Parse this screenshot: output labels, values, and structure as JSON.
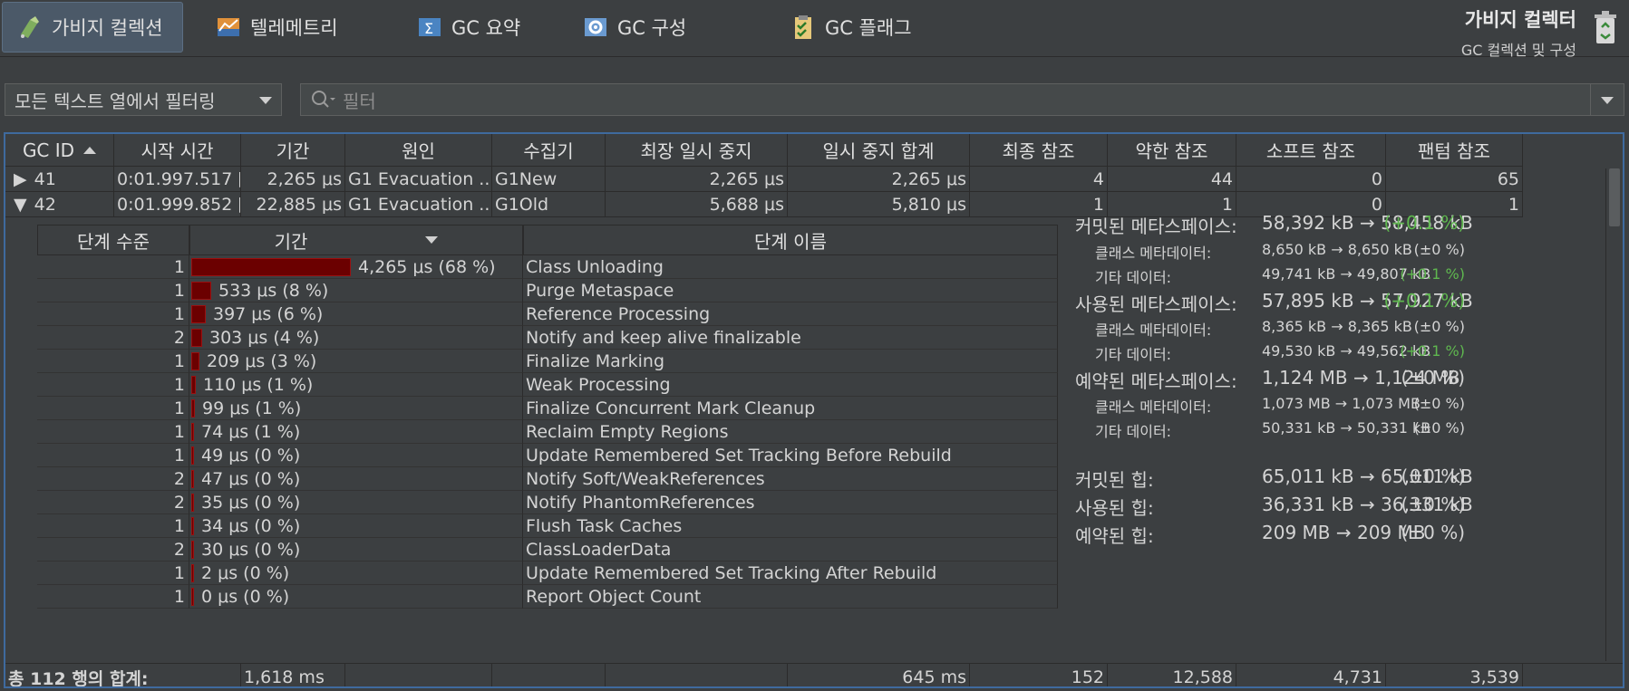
{
  "toolbar": {
    "tabs": [
      {
        "label": "가비지 컬렉션",
        "icon": "garbage-collection-icon",
        "active": true
      },
      {
        "label": "텔레메트리",
        "icon": "telemetry-icon",
        "active": false
      },
      {
        "label": "GC 요약",
        "icon": "gc-summary-icon",
        "active": false
      },
      {
        "label": "GC 구성",
        "icon": "gc-config-icon",
        "active": false
      },
      {
        "label": "GC 플래그",
        "icon": "gc-flags-icon",
        "active": false
      }
    ],
    "title": "가비지 컬렉터",
    "subtitle": "GC 컬렉션 및 구성"
  },
  "filter": {
    "select_value": "모든 텍스트 열에서 필터링",
    "search_placeholder": "필터"
  },
  "table": {
    "columns": [
      "GC ID",
      "시작 시간",
      "기간",
      "원인",
      "수집기",
      "최장 일시 중지",
      "일시 중지 합계",
      "최종 참조",
      "약한 참조",
      "소프트 참조",
      "팬텀 참조"
    ],
    "rows": [
      {
        "expanded": false,
        "id": "41",
        "start": "0:01.997.517 [...",
        "duration": "2,265 μs",
        "cause": "G1 Evacuation ...",
        "collector": "G1New",
        "longest": "2,265 μs",
        "sum": "2,265 μs",
        "final": "4",
        "weak": "44",
        "soft": "0",
        "phantom": "65"
      },
      {
        "expanded": true,
        "id": "42",
        "start": "0:01.999.852 [...",
        "duration": "22,885 μs",
        "cause": "G1 Evacuation ...",
        "collector": "G1Old",
        "longest": "5,688 μs",
        "sum": "5,810 μs",
        "final": "1",
        "weak": "1",
        "soft": "0",
        "phantom": "1"
      }
    ],
    "footer": {
      "label": "총 112 행의 합계:",
      "duration": "1,618 ms",
      "sum": "645 ms",
      "final": "152",
      "weak": "12,588",
      "soft": "4,731",
      "phantom": "3,539"
    }
  },
  "phases": {
    "columns": [
      "단계 수준",
      "기간",
      "단계 이름"
    ],
    "bar_color": "#6b0000",
    "rows": [
      {
        "level": "1",
        "duration": "4,265 μs (68 %)",
        "fraction": 0.68,
        "name": "Class Unloading"
      },
      {
        "level": "1",
        "duration": "533 μs (8 %)",
        "fraction": 0.085,
        "name": "Purge Metaspace"
      },
      {
        "level": "1",
        "duration": "397 μs (6 %)",
        "fraction": 0.063,
        "name": "Reference Processing"
      },
      {
        "level": "2",
        "duration": "303 μs (4 %)",
        "fraction": 0.048,
        "name": "Notify and keep alive finalizable"
      },
      {
        "level": "1",
        "duration": "209 μs (3 %)",
        "fraction": 0.033,
        "name": "Finalize Marking"
      },
      {
        "level": "1",
        "duration": "110 μs (1 %)",
        "fraction": 0.018,
        "name": "Weak Processing"
      },
      {
        "level": "1",
        "duration": "99 μs (1 %)",
        "fraction": 0.016,
        "name": "Finalize Concurrent Mark Cleanup"
      },
      {
        "level": "1",
        "duration": "74 μs (1 %)",
        "fraction": 0.012,
        "name": "Reclaim Empty Regions"
      },
      {
        "level": "1",
        "duration": "49 μs (0 %)",
        "fraction": 0.008,
        "name": "Update Remembered Set Tracking Before Rebuild"
      },
      {
        "level": "2",
        "duration": "47 μs (0 %)",
        "fraction": 0.0075,
        "name": "Notify Soft/WeakReferences"
      },
      {
        "level": "2",
        "duration": "35 μs (0 %)",
        "fraction": 0,
        "name": "Notify PhantomReferences"
      },
      {
        "level": "1",
        "duration": "34 μs (0 %)",
        "fraction": 0,
        "name": "Flush Task Caches"
      },
      {
        "level": "2",
        "duration": "30 μs (0 %)",
        "fraction": 0,
        "name": "ClassLoaderData"
      },
      {
        "level": "1",
        "duration": "2 μs (0 %)",
        "fraction": 0,
        "name": "Update Remembered Set Tracking After Rebuild"
      },
      {
        "level": "1",
        "duration": "0 μs (0 %)",
        "fraction": 0,
        "name": "Report Object Count"
      }
    ]
  },
  "memory": {
    "green_color": "#5fb84f",
    "rows": [
      {
        "label": "커밋된 메타스페이스:",
        "value": "58,392 kB → 58,458 kB",
        "pct": "(+0.1 %)",
        "size": "big",
        "green": true
      },
      {
        "label": "클래스 메타데이터:",
        "value": "8,650 kB → 8,650 kB",
        "pct": "(±0 %)",
        "size": "small",
        "green": false
      },
      {
        "label": "기타 데이터:",
        "value": "49,741 kB → 49,807 kB",
        "pct": "(+0.1 %)",
        "size": "small",
        "green": true
      },
      {
        "label": "사용된 메타스페이스:",
        "value": "57,895 kB → 57,927 kB",
        "pct": "(+0.1 %)",
        "size": "big",
        "green": true
      },
      {
        "label": "클래스 메타데이터:",
        "value": "8,365 kB → 8,365 kB",
        "pct": "(±0 %)",
        "size": "small",
        "green": false
      },
      {
        "label": "기타 데이터:",
        "value": "49,530 kB → 49,562 kB",
        "pct": "(+0.1 %)",
        "size": "small",
        "green": true
      },
      {
        "label": "예약된 메타스페이스:",
        "value": "1,124 MB → 1,124 MB",
        "pct": "(±0 %)",
        "size": "big",
        "green": false
      },
      {
        "label": "클래스 메타데이터:",
        "value": "1,073 MB → 1,073 MB",
        "pct": "(±0 %)",
        "size": "small",
        "green": false
      },
      {
        "label": "기타 데이터:",
        "value": "50,331 kB → 50,331 kB",
        "pct": "(±0 %)",
        "size": "small",
        "green": false
      },
      {
        "label": "커밋된 힙:",
        "value": "65,011 kB → 65,011 kB",
        "pct": "(±0 %)",
        "size": "big",
        "green": false
      },
      {
        "label": "사용된 힙:",
        "value": "36,331 kB → 36,331 kB",
        "pct": "(±0 %)",
        "size": "big",
        "green": false
      },
      {
        "label": "예약된 힙:",
        "value": "209 MB → 209 MB",
        "pct": "(±0 %)",
        "size": "big",
        "green": false
      }
    ]
  }
}
